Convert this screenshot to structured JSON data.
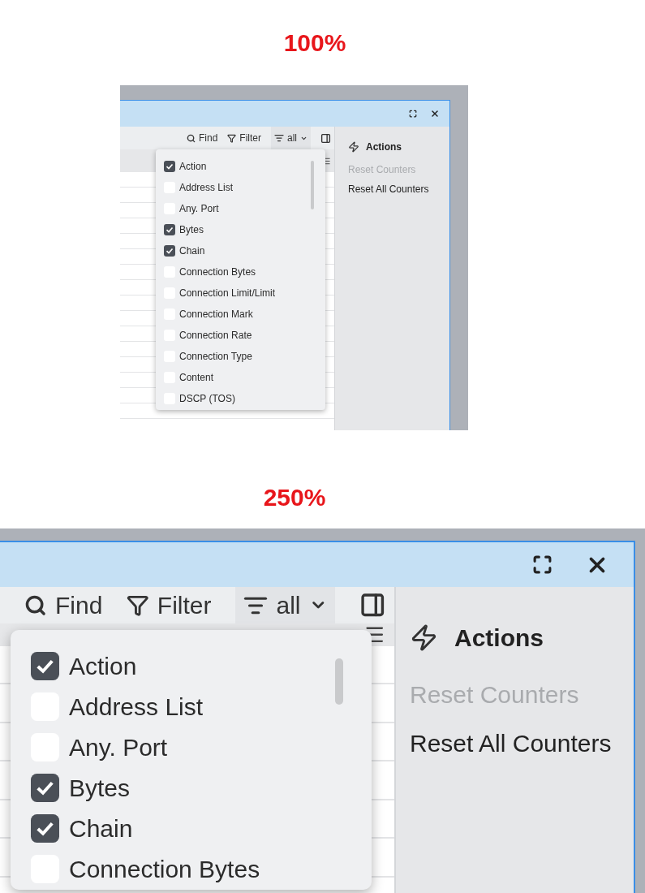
{
  "views": [
    {
      "heading": "100%",
      "toolbar": {
        "find": "Find",
        "filter": "Filter",
        "view": "all"
      },
      "columns_menu": [
        {
          "label": "Action",
          "checked": true
        },
        {
          "label": "Address List",
          "checked": false
        },
        {
          "label": "Any. Port",
          "checked": false
        },
        {
          "label": "Bytes",
          "checked": true
        },
        {
          "label": "Chain",
          "checked": true
        },
        {
          "label": "Connection Bytes",
          "checked": false
        },
        {
          "label": "Connection Limit/Limit",
          "checked": false
        },
        {
          "label": "Connection Mark",
          "checked": false
        },
        {
          "label": "Connection Rate",
          "checked": false
        },
        {
          "label": "Connection Type",
          "checked": false
        },
        {
          "label": "Content",
          "checked": false
        },
        {
          "label": "DSCP (TOS)",
          "checked": false
        }
      ],
      "actions": {
        "title": "Actions",
        "items": [
          {
            "label": "Reset Counters",
            "disabled": true
          },
          {
            "label": "Reset All Counters",
            "disabled": false
          }
        ]
      }
    },
    {
      "heading": "250%",
      "toolbar": {
        "find": "Find",
        "filter": "Filter",
        "view": "all"
      },
      "columns_menu": [
        {
          "label": "Action",
          "checked": true
        },
        {
          "label": "Address List",
          "checked": false
        },
        {
          "label": "Any. Port",
          "checked": false
        },
        {
          "label": "Bytes",
          "checked": true
        },
        {
          "label": "Chain",
          "checked": true
        },
        {
          "label": "Connection Bytes",
          "checked": false
        }
      ],
      "actions": {
        "title": "Actions",
        "items": [
          {
            "label": "Reset Counters",
            "disabled": true
          },
          {
            "label": "Reset All Counters",
            "disabled": false
          }
        ]
      }
    }
  ]
}
